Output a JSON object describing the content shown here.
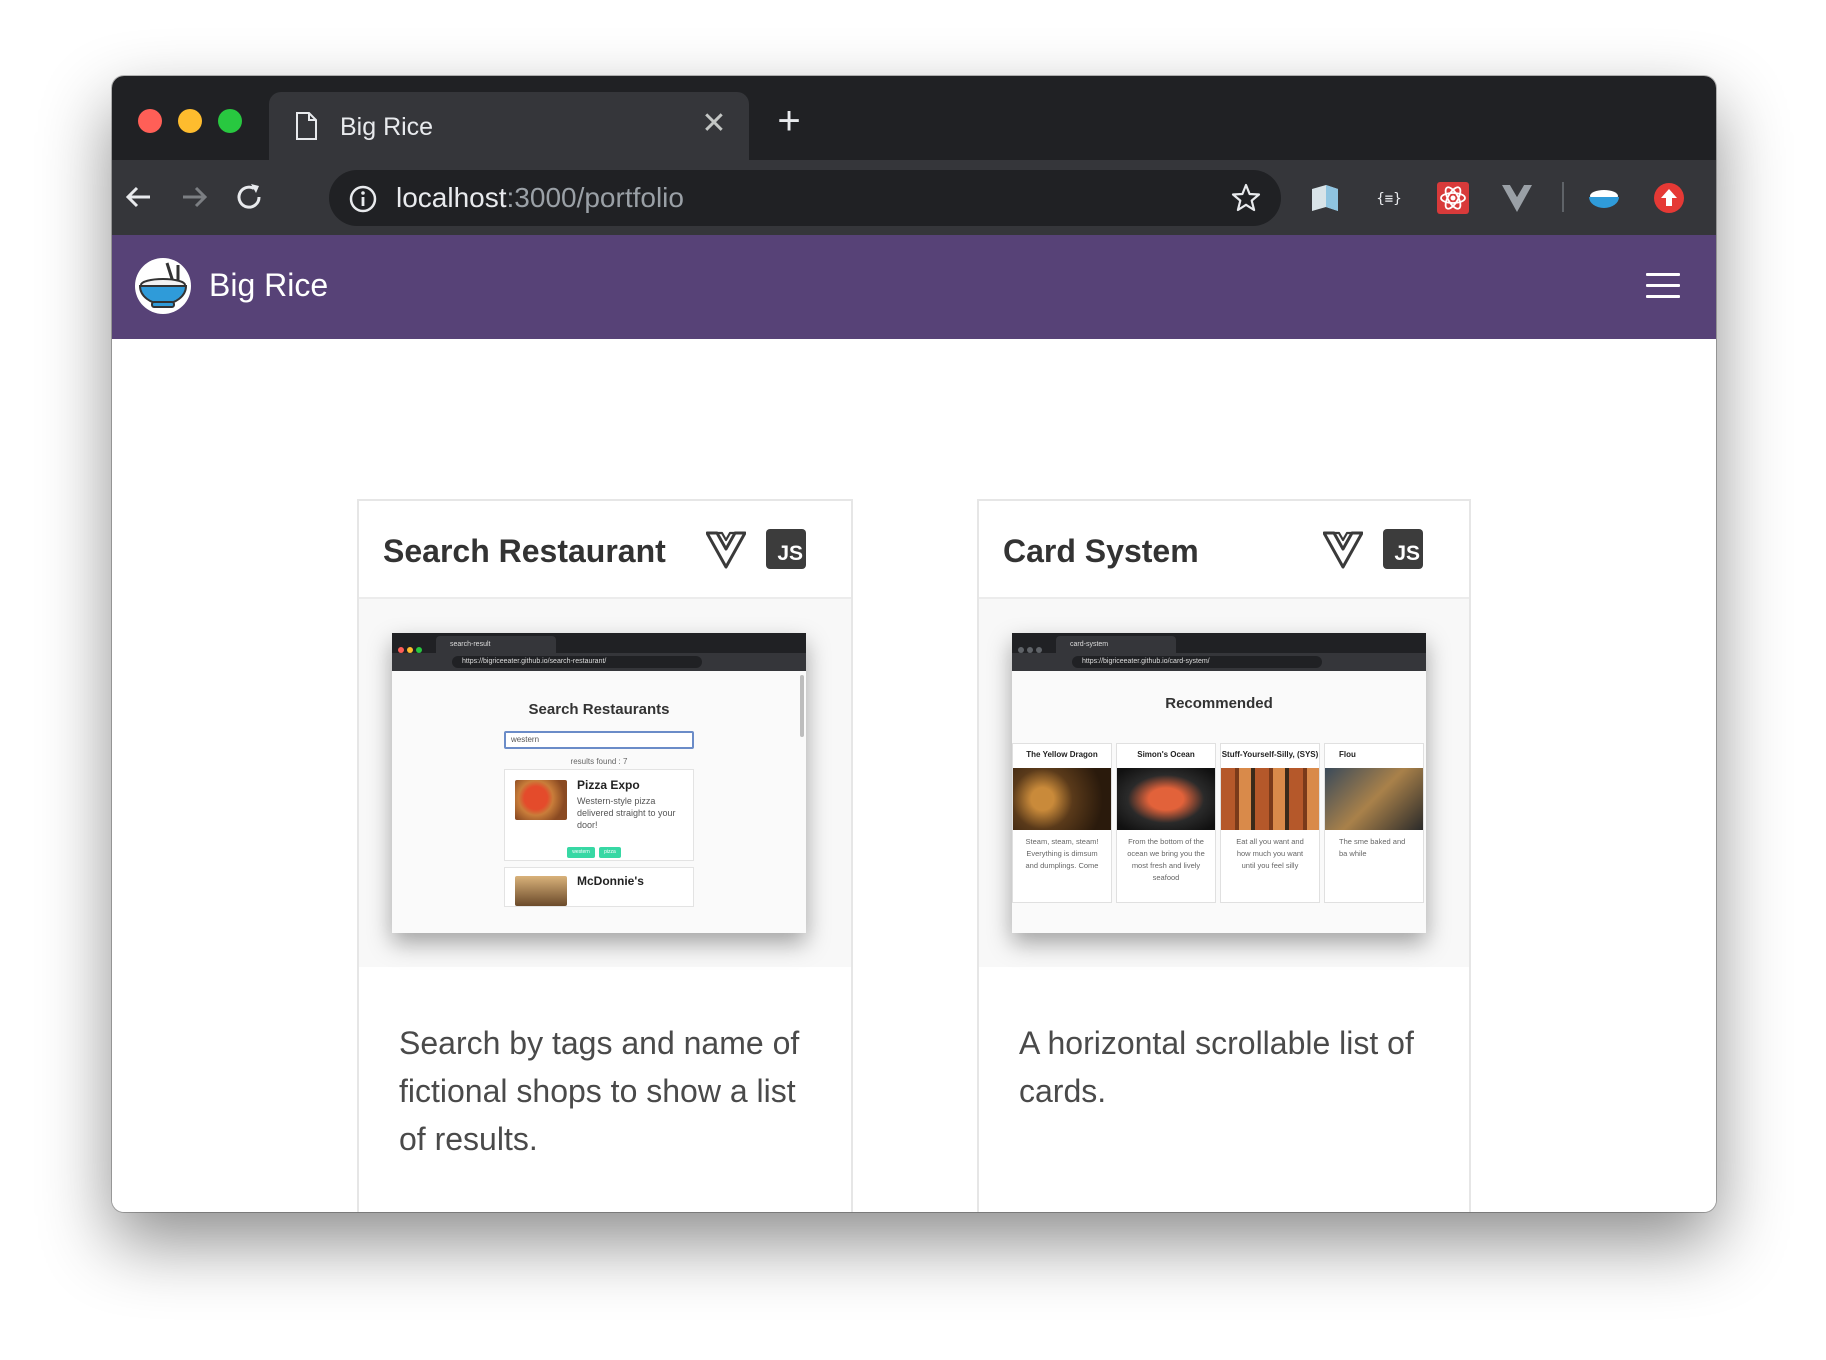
{
  "browser": {
    "tab_title": "Big Rice",
    "url_host": "localhost",
    "url_rest": ":3000/portfolio"
  },
  "site": {
    "brand": "Big Rice",
    "accent_color": "#574277"
  },
  "cards": [
    {
      "title": "Search Restaurant",
      "tech": [
        "vue-icon",
        "js-icon"
      ],
      "js_label": "JS",
      "description": "Search by tags and name of fictional shops to show a list of results.",
      "preview": {
        "tab": "search-result",
        "url": "https://bigriceeater.github.io/search-restaurant/",
        "heading": "Search Restaurants",
        "input_value": "western",
        "results_label": "results found : 7",
        "items": [
          {
            "name": "Pizza Expo",
            "desc": "Western-style pizza delivered straight to your door!",
            "tags": [
              "western",
              "pizza"
            ]
          },
          {
            "name": "McDonnie's"
          }
        ]
      }
    },
    {
      "title": "Card System",
      "tech": [
        "vue-icon",
        "js-icon"
      ],
      "js_label": "JS",
      "description": "A horizontal scrollable list of cards.",
      "preview": {
        "tab": "card-system",
        "url": "https://bigriceeater.github.io/card-system/",
        "heading": "Recommended",
        "cards": [
          {
            "name": "The Yellow Dragon",
            "text": "Steam, steam, steam! Everything is dimsum and dumplings. Come"
          },
          {
            "name": "Simon's Ocean",
            "text": "From the bottom of the ocean we bring you the most fresh and lively seafood"
          },
          {
            "name": "Stuff-Yourself-Silly, (SYS)",
            "text": "Eat all you want and how much you want until you feel silly"
          },
          {
            "name": "Flou",
            "text": "The sme baked and ba while"
          }
        ]
      }
    }
  ]
}
